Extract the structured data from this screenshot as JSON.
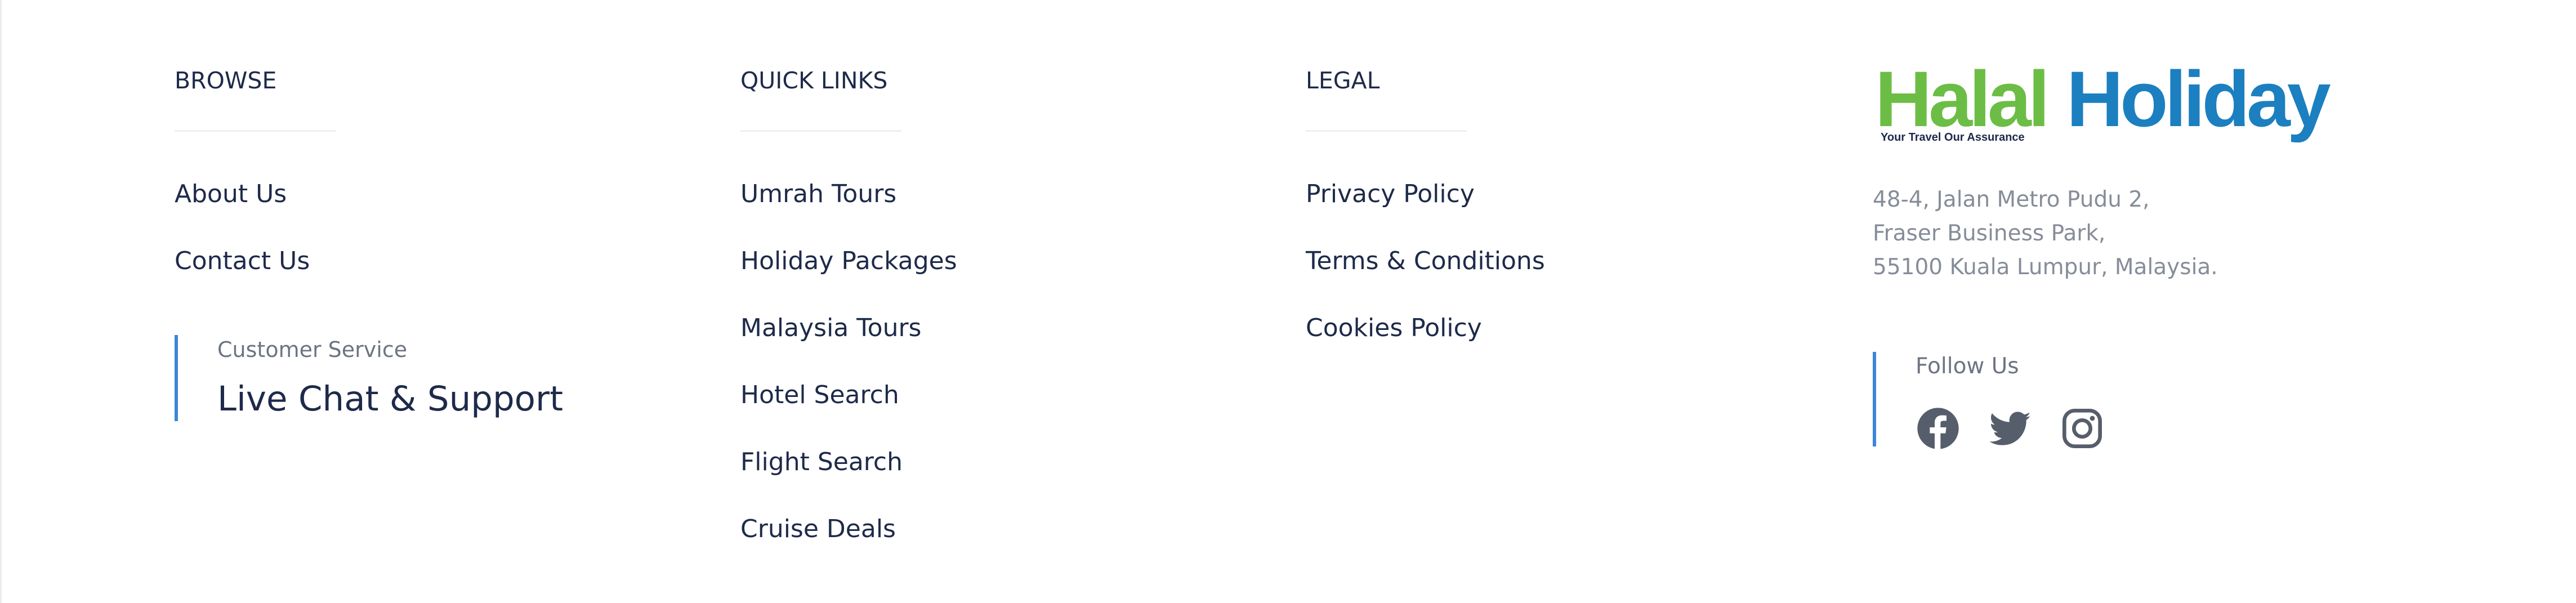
{
  "browse": {
    "heading": "BROWSE",
    "links": [
      "About Us",
      "Contact Us"
    ],
    "customer_service": {
      "label": "Customer Service",
      "value": "Live Chat & Support"
    }
  },
  "quick_links": {
    "heading": "QUICK LINKS",
    "links": [
      "Umrah Tours",
      "Holiday Packages",
      "Malaysia Tours",
      "Hotel Search",
      "Flight Search",
      "Cruise Deals"
    ]
  },
  "legal": {
    "heading": "LEGAL",
    "links": [
      "Privacy Policy",
      "Terms & Conditions",
      "Cookies Policy"
    ]
  },
  "brand": {
    "logo_word_1": "Halal",
    "logo_word_2": "Holiday",
    "tagline": "Your Travel Our Assurance",
    "logo_colors": {
      "halal": "#6cbd45",
      "holiday": "#1b7fc0"
    },
    "address": [
      "48-4, Jalan Metro Pudu 2,",
      "Fraser Business Park,",
      "55100 Kuala Lumpur, Malaysia."
    ],
    "follow_label": "Follow Us",
    "social_icons": [
      "facebook-icon",
      "twitter-icon",
      "instagram-icon"
    ]
  },
  "colors": {
    "text_dark": "#1e2a4a",
    "text_muted": "#6d7482",
    "accent_border": "#3b86d8",
    "social_icon": "#565d6b"
  }
}
